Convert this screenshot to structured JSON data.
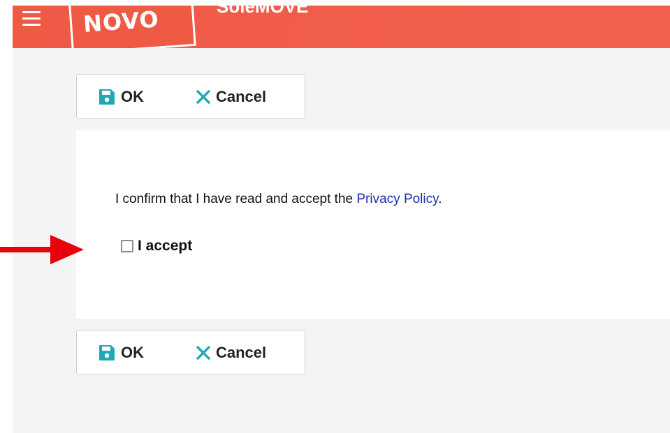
{
  "header": {
    "logo_text": "NOVO",
    "app_name": "SoleMOVE",
    "color": "#ef5a45"
  },
  "toolbar_top": {
    "ok_label": "OK",
    "cancel_label": "Cancel"
  },
  "toolbar_bottom": {
    "ok_label": "OK",
    "cancel_label": "Cancel"
  },
  "consent": {
    "text_before": "I confirm that I have read and accept the ",
    "link_text": "Privacy Policy",
    "text_after": ".",
    "checkbox_label": "I accept",
    "checked": false
  },
  "icons": {
    "save": "save-icon",
    "cancel": "close-icon",
    "annotation": "red-arrow-icon"
  },
  "colors": {
    "accent": "#21a8b6",
    "link": "#1c2fae",
    "annotation": "#e8000b"
  }
}
